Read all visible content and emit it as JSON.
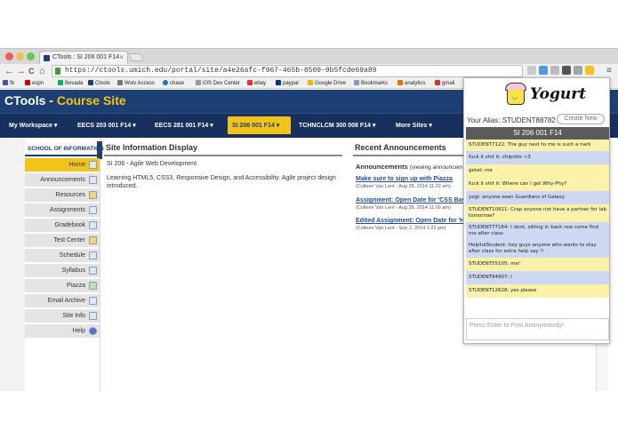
{
  "browser": {
    "tab_title": "CTools : SI 206 001 F14",
    "tab_close": "×",
    "url": "https://ctools.umich.edu/portal/site/a4e26afc-f967-465b-8509-9b5fcde69a89",
    "nav": {
      "back": "←",
      "forward": "→",
      "reload": "C",
      "home": "⌂"
    },
    "window_menu": "≡",
    "bookmarks": [
      "fb",
      "espn",
      "Bovada",
      "Ctools",
      "Wolv Access",
      "chase",
      "iOS Dev Center",
      "ebay",
      "paypal",
      "Google Drive",
      "Bookmarks",
      "analytics",
      "gmail"
    ]
  },
  "site": {
    "title_main": "CTools - ",
    "title_accent": "Course Site"
  },
  "topnav": {
    "items": [
      "My Workspace ▾",
      "EECS 203 001 F14 ▾",
      "EECS 281 001 F14 ▾",
      "SI 206 001 F14 ▾",
      "TCHNCLCM 300 008 F14 ▾",
      "More Sites ▾"
    ]
  },
  "toolmenu": {
    "header": "SCHOOL OF INFORMATION",
    "items": [
      "Home",
      "Announcements",
      "Resources",
      "Assignments",
      "Gradebook",
      "Test Center",
      "Schedule",
      "Syllabus",
      "Piazza",
      "Email Archive",
      "Site Info",
      "Help"
    ]
  },
  "site_info": {
    "title": "Site Information Display",
    "subtitle": "SI 206 - Agile Web Development",
    "description": "Learning HTML5, CSS3, Responsive Design, and Accessibility.  Agile project design introduced."
  },
  "announcements": {
    "title": "Recent Announcements",
    "subheading": "Announcements",
    "viewing": "(viewing announcem",
    "items": [
      {
        "title": "Make sure to sign up with Piazza",
        "meta": "(Colleen Van Lent - Aug 28, 2014 11:22 am)"
      },
      {
        "title": "Assignment: Open Date for 'CSS Bas",
        "meta": "(Colleen Van Lent - Aug 28, 2014 11:09 am)"
      },
      {
        "title": "Edited Assignment: Open Date for 'H",
        "meta": "(Colleen Van Lent - Sep 2, 2014 1:22 pm)"
      }
    ]
  },
  "yogurt": {
    "logo_text": "Yogurt",
    "logo_face": "◡",
    "alias": "Your Alias: STUDENT88782",
    "create_new": "Create New",
    "room": "SI 206 001 F14",
    "messages": [
      {
        "text": "STUDENT7122: The guy next to me is such a nark",
        "color": "yellow"
      },
      {
        "text": "fuck it shit it: chipotle <3",
        "color": "blue"
      },
      {
        "text": "getat: me",
        "color": "yellow"
      },
      {
        "text": "fuck it shit it: Where can I get Why-Phy?",
        "color": "yellow"
      },
      {
        "text": "yogi: anyone seen Guardians of Galaxy",
        "color": "blue"
      },
      {
        "text": "STUDENT10911: Crap anyone not have a partner for lab tomorrow?",
        "color": "yellow"
      },
      {
        "text": "STUDENT77164: I dont, sitting in back row come find me after class",
        "color": "blue"
      },
      {
        "text": "HelpfulStudent: hey guys anyone who wants to stay after class for extra help say !!",
        "color": "blue"
      },
      {
        "text": "STUDENT55105: me!",
        "color": "yellow"
      },
      {
        "text": "STUDENT94907: I",
        "color": "blue"
      },
      {
        "text": "STUDENT12628: yes please",
        "color": "yellow"
      }
    ],
    "compose_placeholder": "Press Enter to Post Anonymously!"
  }
}
